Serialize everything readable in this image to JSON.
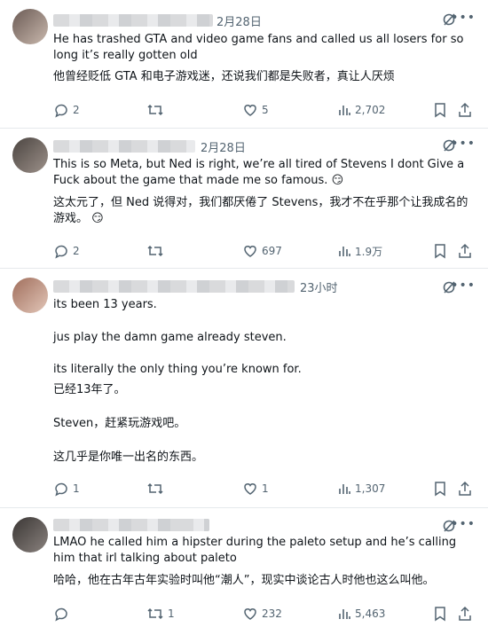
{
  "tweets": [
    {
      "date": "2月28日",
      "lines": [
        "He has trashed GTA and video game fans and called us all losers for so long it’s really gotten old",
        "他曾经贬低 GTA 和电子游戏迷，还说我们都是失败者，真让人厌烦"
      ],
      "replies": "2",
      "retweets": "",
      "likes": "5",
      "views": "2,702"
    },
    {
      "date": "2月28日",
      "lines": [
        "This is so Meta, but Ned is right, we’re all tired of Stevens I dont Give a Fuck about the game that made me so famous. 😏",
        "这太元了，但 Ned 说得对，我们都厌倦了 Stevens，我才不在乎那个让我成名的游戏。 😏"
      ],
      "replies": "2",
      "retweets": "",
      "likes": "697",
      "views": "1.9万"
    },
    {
      "date": "23小时",
      "lines": [
        "its been 13 years.",
        "jus play the damn game already steven.",
        "its literally the only thing you’re known for.",
        "已经13年了。",
        "Steven，赶紧玩游戏吧。",
        "这几乎是你唯一出名的东西。"
      ],
      "replies": "1",
      "retweets": "",
      "likes": "1",
      "views": "1,307"
    },
    {
      "date": "",
      "lines": [
        "LMAO he called him a hipster during the paleto setup and he’s calling him that irl talking about paleto",
        "哈哈，他在古年古年实验时叫他“潮人”，现实中谈论古人时他也这么叫他。"
      ],
      "replies": "",
      "retweets": "1",
      "likes": "232",
      "views": "5,463"
    }
  ],
  "icons": {
    "reply": "reply-icon",
    "retweet": "retweet-icon",
    "like": "heart-icon",
    "views": "views-icon",
    "bookmark": "bookmark-icon",
    "share": "share-icon",
    "grok": "grok-icon",
    "more": "more-icon"
  },
  "colors": {
    "text": "#0f1419",
    "muted": "#536471",
    "divider": "#e6e9ec"
  }
}
